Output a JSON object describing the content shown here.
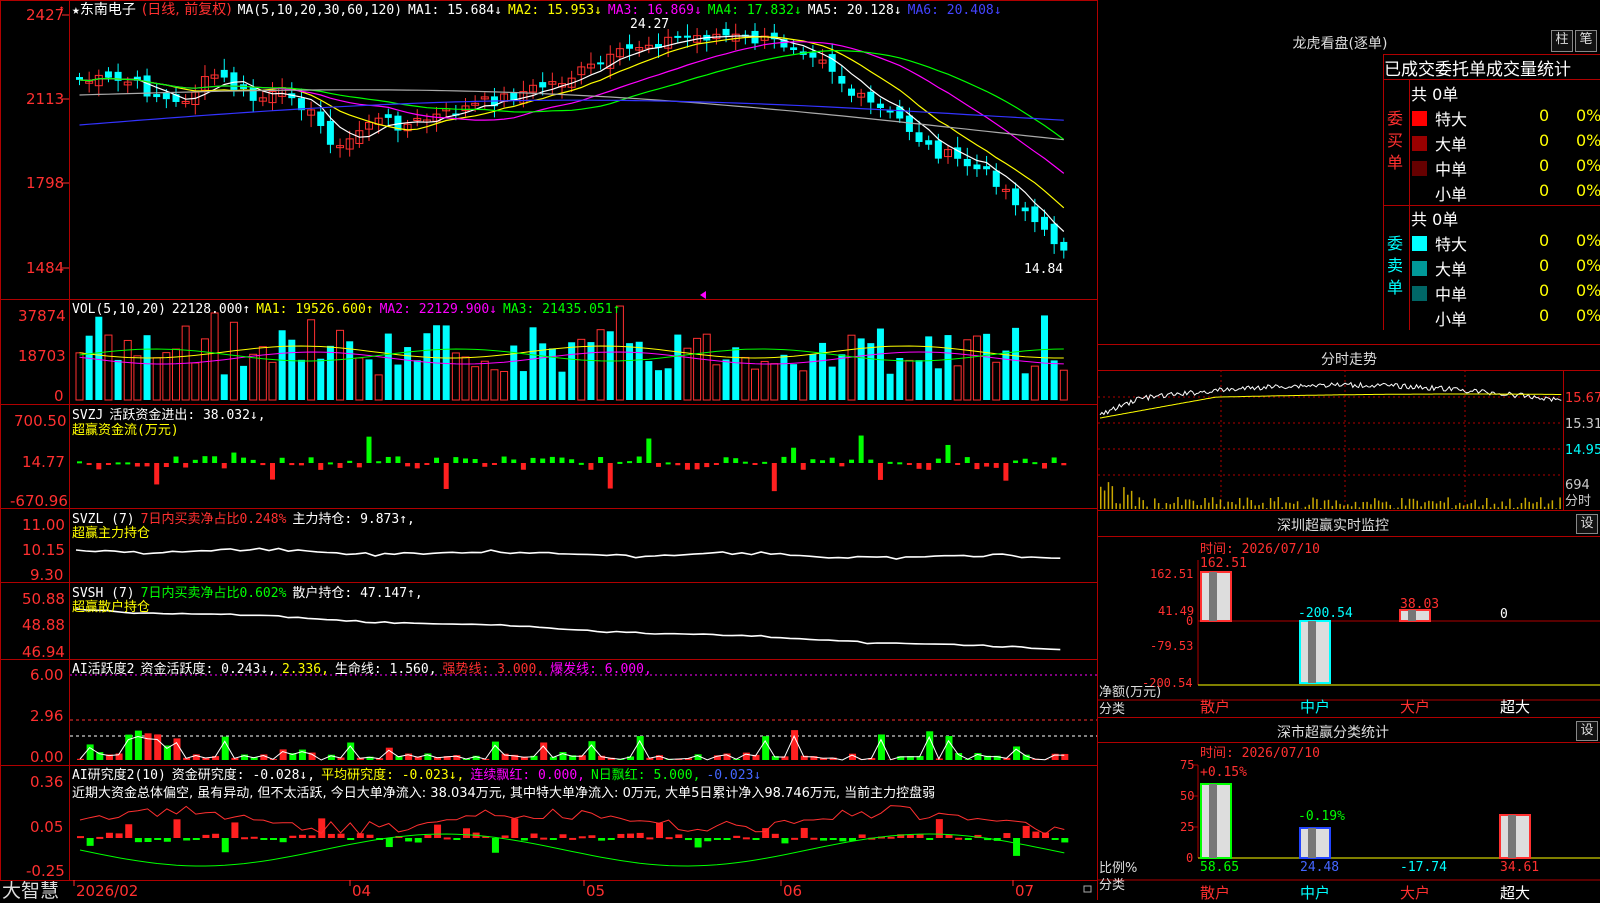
{
  "main_chart": {
    "stock_name": "东南电子",
    "mode": "(日线, 前复权)",
    "ma_label": "MA(5,10,20,30,60,120)",
    "ma": [
      {
        "label": "MA1:",
        "value": "15.684↓",
        "color": "#ffffff"
      },
      {
        "label": "MA2:",
        "value": "15.953↓",
        "color": "#ffff00"
      },
      {
        "label": "MA3:",
        "value": "16.869↓",
        "color": "#ff00ff"
      },
      {
        "label": "MA4:",
        "value": "17.832↓",
        "color": "#00ff00"
      },
      {
        "label": "MA5:",
        "value": "20.128↓",
        "color": "#ffffff"
      },
      {
        "label": "MA6:",
        "value": "20.408↓",
        "color": "#4444ff"
      }
    ],
    "y_ticks": [
      "2427",
      "2113",
      "1798",
      "1484"
    ],
    "high_label": "24.27",
    "low_label": "14.84"
  },
  "vol_panel": {
    "title": "VOL(5,10,20)",
    "value": "22128.000↑",
    "ma1": "MA1: 19526.600↑",
    "ma2": "MA2: 22129.900↓",
    "ma3": "MA3: 21435.051↑",
    "y_ticks": [
      "37874",
      "18703",
      "0"
    ]
  },
  "svzj_panel": {
    "title": "SVZJ",
    "desc": "活跃资金进出: 38.032↓,",
    "sub": "超赢资金流(万元)",
    "y_ticks": [
      "700.50",
      "14.77",
      "-670.96"
    ]
  },
  "svzl_panel": {
    "title": "SVZL (7)",
    "desc": "7日内买卖净占比0.248%",
    "desc2": "主力持仓: 9.873↑,",
    "sub": "超赢主力持仓",
    "y_ticks": [
      "11.00",
      "10.15",
      "9.30"
    ]
  },
  "svsh_panel": {
    "title": "SVSH (7)",
    "desc": "7日内买卖净占比0.602%",
    "desc2": "散户持仓: 47.147↑,",
    "sub": "超赢散户持仓",
    "y_ticks": [
      "50.88",
      "48.88",
      "46.94"
    ]
  },
  "ai_active": {
    "title": "AI活跃度2",
    "desc": "资金活跃度: 0.243↓,",
    "v2": "2.336,",
    "life": "生命线: 1.560,",
    "strong": "强势线: 3.000,",
    "burst": "爆发线: 6.000,",
    "y_ticks": [
      "6.00",
      "2.96",
      "0.00"
    ]
  },
  "ai_research": {
    "title": "AI研究度2(10)",
    "desc": "资金研究度: -0.028↓,",
    "avg": "平均研究度: -0.023↓,",
    "red": "连续飘红: 0.000,",
    "nred": "N日飘红: 5.000,",
    "last": "-0.023↓",
    "comment": "近期大资金总体偏空, 虽有异动, 但不太活跃, 今日大单净流入: 38.034万元, 其中特大单净流入: 0万元, 大单5日累计净入98.746万元, 当前主力控盘弱",
    "y_ticks": [
      "0.36",
      "0.05",
      "-0.25"
    ]
  },
  "date_axis": {
    "labels": [
      "2026/02",
      "04",
      "05",
      "06",
      "07"
    ]
  },
  "brand": "大智慧",
  "right_panel": {
    "dragon_title": "龙虎看盘(逐单)",
    "btn_bar": "柱",
    "btn_pen": "笔",
    "stats_title": "已成交委托单成交量统计",
    "buy_side": {
      "side_label": "委买单",
      "total": "共 0单",
      "rows": [
        {
          "name": "特大",
          "val": "0",
          "pct": "0%",
          "color": "#ff0000"
        },
        {
          "name": "大单",
          "val": "0",
          "pct": "0%",
          "color": "#990000"
        },
        {
          "name": "中单",
          "val": "0",
          "pct": "0%",
          "color": "#660000"
        },
        {
          "name": "小单",
          "val": "0",
          "pct": "0%",
          "color": "#000000"
        }
      ]
    },
    "sell_side": {
      "side_label": "委卖单",
      "total": "共 0单",
      "rows": [
        {
          "name": "特大",
          "val": "0",
          "pct": "0%",
          "color": "#00ffff"
        },
        {
          "name": "大单",
          "val": "0",
          "pct": "0%",
          "color": "#009999"
        },
        {
          "name": "中单",
          "val": "0",
          "pct": "0%",
          "color": "#006666"
        },
        {
          "name": "小单",
          "val": "0",
          "pct": "0%",
          "color": "#000000"
        }
      ]
    },
    "intraday_title": "分时走势",
    "intraday_ticks": [
      "15.67",
      "15.31",
      "14.95"
    ],
    "intraday_vol": "694",
    "intraday_vol_label": "分时",
    "monitor_title": "深圳超赢实时监控",
    "set": "设",
    "monitor_time": "时间: 2026/07/10",
    "monitor_ticks": [
      "162.51",
      "41.49",
      "0",
      "-79.53",
      "-200.54"
    ],
    "monitor_values": [
      "162.51",
      "-200.54",
      "38.03",
      "0"
    ],
    "monitor_ylabel": "净额(万元)",
    "monitor_xlabel": "分类",
    "categories": [
      "散户",
      "中户",
      "大户",
      "超大"
    ],
    "class_title": "深市超赢分类统计",
    "class_time": "时间: 2026/07/10",
    "class_ticks": [
      "75",
      "50",
      "25",
      "0"
    ],
    "class_top": [
      "+0.15%",
      "-0.19%"
    ],
    "class_bottom": [
      "58.65",
      "24.48",
      "-17.74",
      "34.61"
    ],
    "class_ylabel": "比例%",
    "class_xlabel": "分类"
  }
}
